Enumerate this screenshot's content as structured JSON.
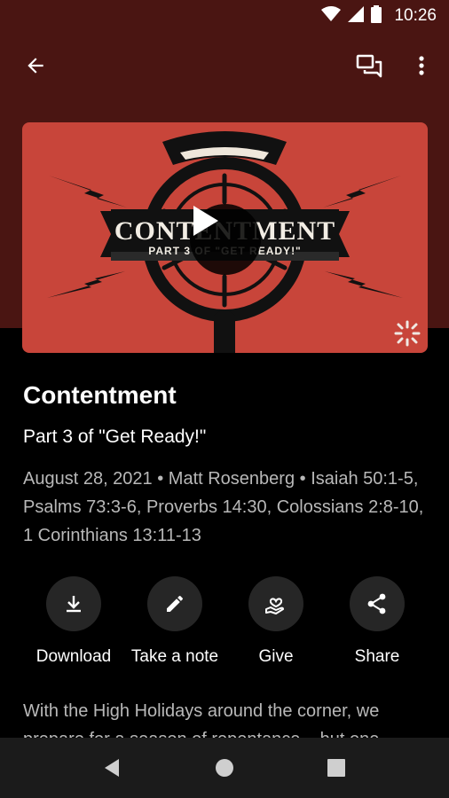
{
  "status_bar": {
    "time": "10:26"
  },
  "artwork": {
    "title_text": "CONTENTMENT",
    "subtitle_text": "PART 3 OF \"GET READY!\"",
    "colors": {
      "background": "#c8453a",
      "ink": "#111111"
    }
  },
  "sermon": {
    "title": "Contentment",
    "subtitle": "Part 3 of \"Get Ready!\"",
    "meta": "August 28, 2021 • Matt Rosenberg • Isaiah 50:1-5, Psalms 73:3-6, Proverbs 14:30, Colossians 2:8-10, 1 Corinthians 13:11-13"
  },
  "actions": [
    {
      "label": "Download",
      "icon": "download-icon"
    },
    {
      "label": "Take a note",
      "icon": "pencil-icon"
    },
    {
      "label": "Give",
      "icon": "give-heart-icon"
    },
    {
      "label": "Share",
      "icon": "share-icon"
    }
  ],
  "description": "With the High Holidays around the corner, we prepare for a season of repentance... but one",
  "colors": {
    "header": "#4a1512",
    "circle": "#262626",
    "muted_text": "#b8b8b8",
    "nav_bar": "#1b1b1b"
  }
}
